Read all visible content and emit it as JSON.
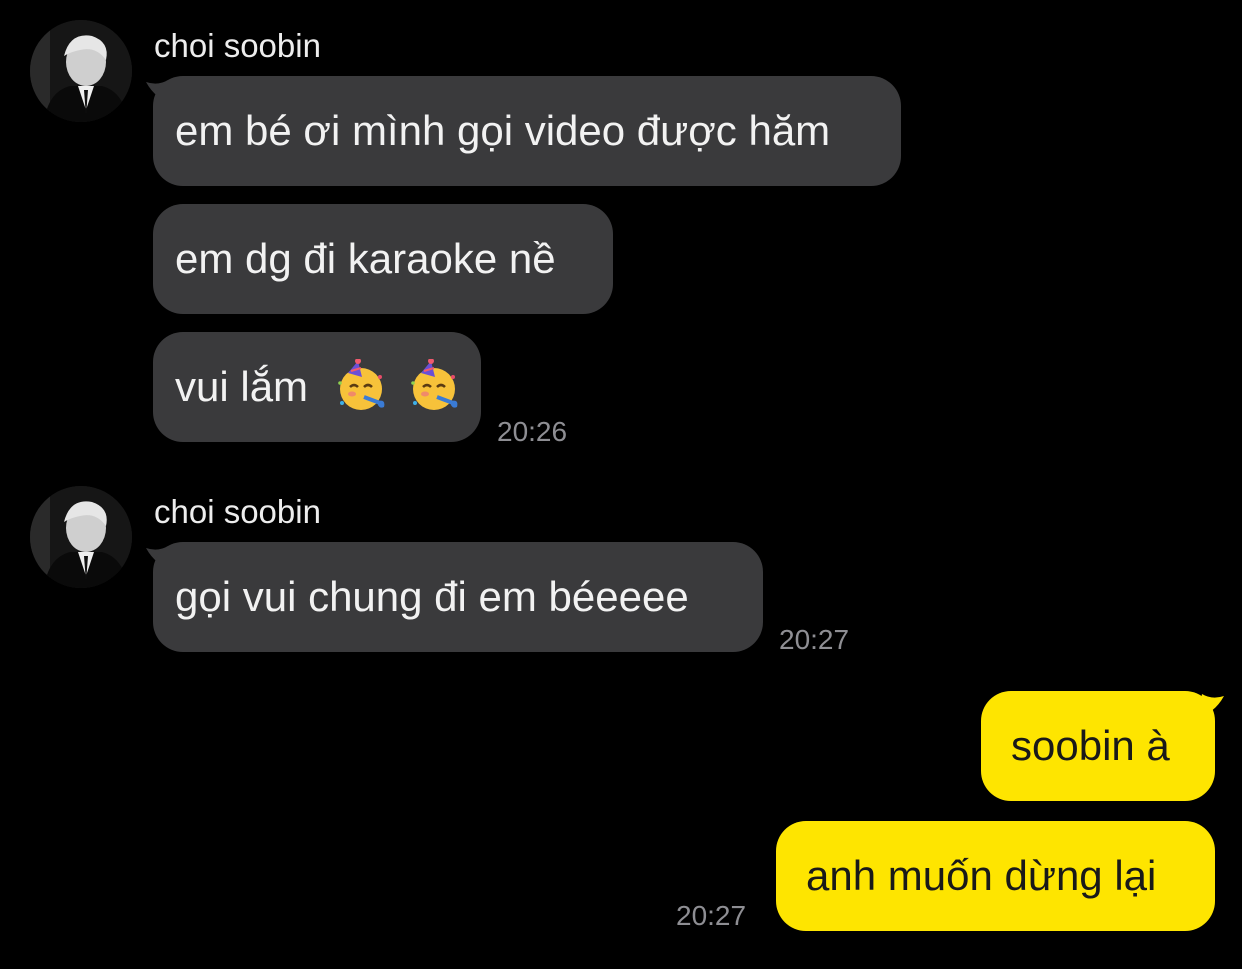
{
  "sender_name": "choi soobin",
  "group1": {
    "messages": [
      "em bé ơi mình gọi video được hăm",
      "em dg đi karaoke nề",
      "vui lắm"
    ],
    "emoji": [
      "partying-face-emoji",
      "partying-face-emoji"
    ],
    "time": "20:26"
  },
  "group2": {
    "messages": [
      "gọi vui chung đi em béeeee"
    ],
    "time": "20:27"
  },
  "outgoing": {
    "messages": [
      "soobin à",
      "anh muốn dừng lại"
    ],
    "time": "20:27"
  },
  "colors": {
    "background": "#000000",
    "incoming_bubble": "#3a3a3c",
    "outgoing_bubble": "#fee500"
  }
}
